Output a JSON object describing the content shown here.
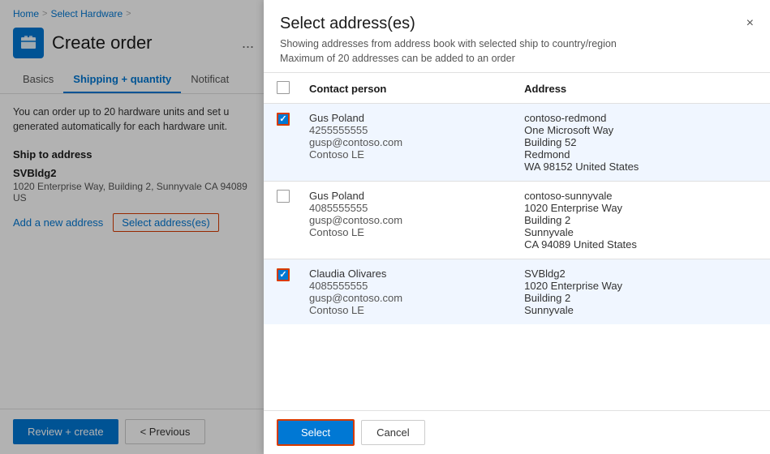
{
  "breadcrumb": {
    "home": "Home",
    "separator1": ">",
    "select_hardware": "Select Hardware",
    "separator2": ">"
  },
  "header": {
    "title": "Create order",
    "ellipsis": "...",
    "icon": "📦"
  },
  "tabs": [
    {
      "label": "Basics",
      "active": false
    },
    {
      "label": "Shipping + quantity",
      "active": true
    },
    {
      "label": "Notificat",
      "active": false
    }
  ],
  "left_content": {
    "description": "You can order up to 20 hardware units and set u generated automatically for each hardware unit.",
    "section_label": "Ship to address",
    "address_name": "SVBldg2",
    "address_detail": "1020 Enterprise Way, Building 2, Sunnyvale CA 94089 US",
    "link_add": "Add a new address",
    "link_select": "Select address(es)"
  },
  "footer": {
    "review_label": "Review + create",
    "previous_label": "< Previous"
  },
  "modal": {
    "title": "Select address(es)",
    "subtitle": "Showing addresses from address book with selected ship to country/region",
    "note": "Maximum of 20 addresses can be added to an order",
    "close_label": "×",
    "table": {
      "col_checkbox": "",
      "col_contact": "Contact person",
      "col_address": "Address"
    },
    "rows": [
      {
        "checked": true,
        "name": "Gus Poland",
        "phone": "4255555555",
        "email": "gusp@contoso.com",
        "company": "Contoso LE",
        "addr1": "contoso-redmond",
        "addr2": "One Microsoft Way",
        "addr3": "Building 52",
        "addr4": "Redmond",
        "addr5": "WA 98152 United States"
      },
      {
        "checked": false,
        "name": "Gus Poland",
        "phone": "4085555555",
        "email": "gusp@contoso.com",
        "company": "Contoso LE",
        "addr1": "contoso-sunnyvale",
        "addr2": "1020 Enterprise Way",
        "addr3": "Building 2",
        "addr4": "Sunnyvale",
        "addr5": "CA 94089 United States"
      },
      {
        "checked": true,
        "name": "Claudia Olivares",
        "phone": "4085555555",
        "email": "gusp@contoso.com",
        "company": "Contoso LE",
        "addr1": "SVBldg2",
        "addr2": "1020 Enterprise Way",
        "addr3": "Building 2",
        "addr4": "Sunnyvale",
        "addr5": ""
      }
    ],
    "select_label": "Select",
    "cancel_label": "Cancel"
  }
}
